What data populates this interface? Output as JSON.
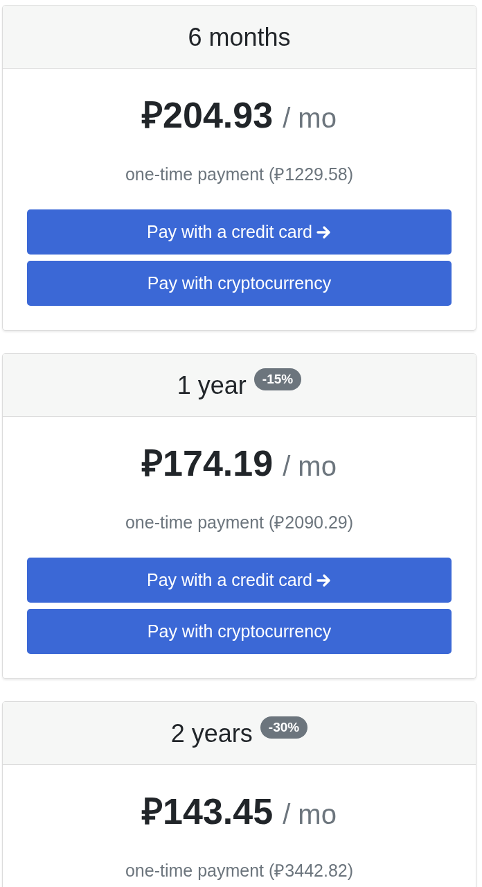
{
  "plans": [
    {
      "title": "6 months",
      "price": "₽204.93",
      "period": "/ mo",
      "note": "one-time payment (₽1229.58)",
      "buttons": [
        {
          "label": "Pay with a credit card",
          "kind": "arrow"
        },
        {
          "label": "Pay with cryptocurrency",
          "kind": "plain"
        }
      ]
    },
    {
      "title": "1 year",
      "badge": "-15%",
      "price": "₽174.19",
      "period": "/ mo",
      "note": "one-time payment (₽2090.29)",
      "buttons": [
        {
          "label": "Pay with a credit card",
          "kind": "arrow"
        },
        {
          "label": "Pay with cryptocurrency",
          "kind": "plain"
        }
      ]
    },
    {
      "title": "2 years",
      "badge": "-30%",
      "price": "₽143.45",
      "period": "/ mo",
      "note": "one-time payment (₽3442.82)"
    }
  ]
}
